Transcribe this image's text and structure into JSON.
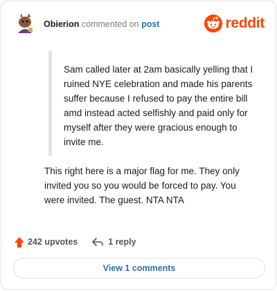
{
  "header": {
    "username": "Obierion",
    "action_text": "commented on",
    "target_text": "post",
    "brand_text": "reddit"
  },
  "comment": {
    "quote_text": "Sam called later at 2am basically yelling that I ruined NYE celebration and made his parents suffer because I refused to pay the entire bill amd instead acted selfishly and paid only for myself after they were gracious enough to invite me.",
    "body_text": "This right here is a major flag for me. They only invited you so you would be forced to pay. You were invited. The guest. NTA NTA"
  },
  "actions": {
    "upvotes_label": "242 upvotes",
    "reply_label": "1 reply"
  },
  "view_comments_label": "View 1 comments",
  "icons": {
    "upvote": "upvote-arrow-icon",
    "reply": "reply-arrow-icon",
    "brand": "reddit-snoo-icon"
  },
  "colors": {
    "brand": "#ff4500",
    "link": "#2e6fb0",
    "muted": "#7c7c7c"
  }
}
